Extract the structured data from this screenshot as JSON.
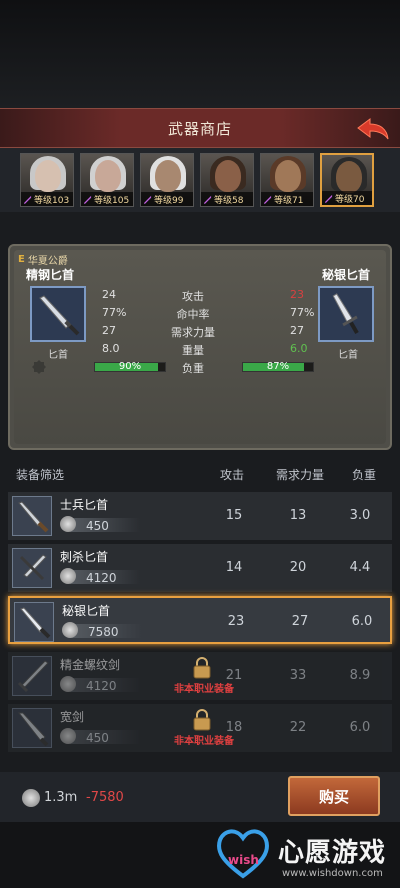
{
  "header": {
    "title": "武器商店"
  },
  "heroes": [
    {
      "level_label": "等级103",
      "hair": "#c8c8c8",
      "skin": "#d6c0b0"
    },
    {
      "level_label": "等级105",
      "hair": "#d0d0d0",
      "skin": "#c8a898"
    },
    {
      "level_label": "等级99",
      "hair": "#e0e0e0",
      "skin": "#a88870"
    },
    {
      "level_label": "等级58",
      "hair": "#3a2a20",
      "skin": "#8a6048"
    },
    {
      "level_label": "等级71",
      "hair": "#5a3a28",
      "skin": "#a07858"
    },
    {
      "level_label": "等级70",
      "hair": "#2a2a2a",
      "skin": "#7a5a40"
    }
  ],
  "compare": {
    "owner_badge": "E",
    "owner_name": "华夏公爵",
    "left_weapon": {
      "name": "精钢匕首",
      "type": "匕首"
    },
    "right_weapon": {
      "name": "秘银匕首",
      "type": "匕首"
    },
    "stats": [
      {
        "label": "攻击",
        "left": "24",
        "right": "23",
        "right_color": "red"
      },
      {
        "label": "命中率",
        "left": "77%",
        "right": "77%",
        "right_color": ""
      },
      {
        "label": "需求力量",
        "left": "27",
        "right": "27",
        "right_color": ""
      },
      {
        "label": "重量",
        "left": "8.0",
        "right": "6.0",
        "right_color": "green"
      }
    ],
    "load": {
      "label": "负重",
      "left_pct": 90,
      "left_text": "90%",
      "right_pct": 87,
      "right_text": "87%"
    }
  },
  "list": {
    "headers": {
      "filter": "装备筛选",
      "attack": "攻击",
      "strength": "需求力量",
      "weight": "负重"
    },
    "non_class_label": "非本职业装备",
    "rows": [
      {
        "name": "士兵匕首",
        "price": "450",
        "attack": "15",
        "strength": "13",
        "weight": "3.0",
        "state": "normal"
      },
      {
        "name": "刺杀匕首",
        "price": "4120",
        "attack": "14",
        "strength": "20",
        "weight": "4.4",
        "state": "normal"
      },
      {
        "name": "秘银匕首",
        "price": "7580",
        "attack": "23",
        "strength": "27",
        "weight": "6.0",
        "state": "selected"
      },
      {
        "name": "精金螺纹剑",
        "price": "4120",
        "attack": "21",
        "strength": "33",
        "weight": "8.9",
        "state": "locked"
      },
      {
        "name": "宽剑",
        "price": "450",
        "attack": "18",
        "strength": "22",
        "weight": "6.0",
        "state": "locked"
      }
    ]
  },
  "footer": {
    "balance": "1.3m",
    "cost": "-7580",
    "buy_label": "购买",
    "watermark_text": "心愿游戏",
    "watermark_url": "www.wishdown.com",
    "watermark_logo": "wish"
  }
}
